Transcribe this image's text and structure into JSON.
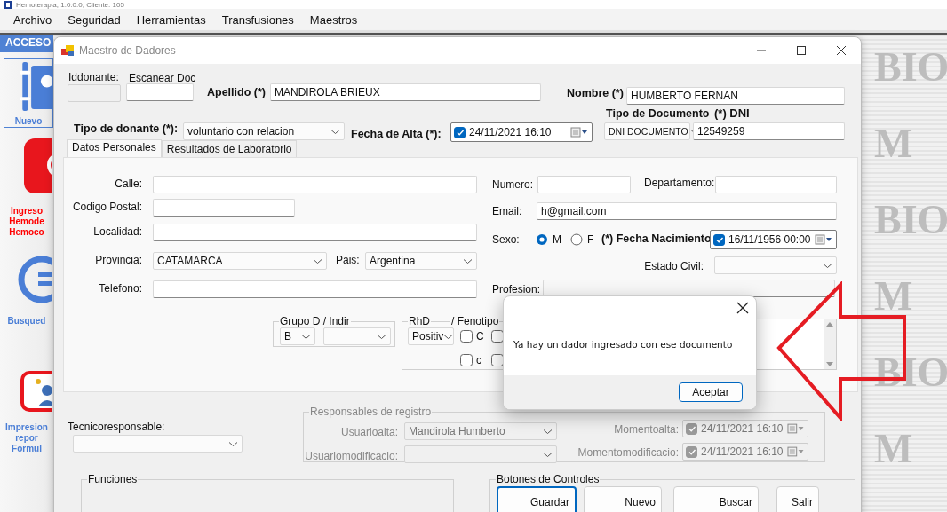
{
  "app": {
    "title": "Hemoterapia, 1.0.0.0, Cliente: 105"
  },
  "menu": [
    {
      "label": "Archivo"
    },
    {
      "label": "Seguridad"
    },
    {
      "label": "Herramientas"
    },
    {
      "label": "Transfusiones"
    },
    {
      "label": "Maestros"
    }
  ],
  "sidebar": {
    "title": "ACCESO",
    "items": [
      {
        "kind": "binder",
        "lines": [
          "Nuevo"
        ],
        "color": "#4a7ed6",
        "selected": true
      },
      {
        "kind": "entry",
        "lines": [
          "Ingreso",
          "Hemode",
          "Hemoco"
        ],
        "color": "#ff0000",
        "selected": false
      },
      {
        "kind": "search",
        "lines": [
          "Busqued"
        ],
        "color": "#4a7ed6",
        "selected": false
      },
      {
        "kind": "print",
        "lines": [
          "Impresion",
          "repor",
          "Formul"
        ],
        "color": "#4a7ed6",
        "selected": false
      }
    ]
  },
  "background_logo": [
    "BIO",
    "M",
    "BIO",
    "M",
    "BIO",
    "M"
  ],
  "dialog": {
    "title": "Maestro de Dadores",
    "header": {
      "iddonante": {
        "label": "Iddonante:",
        "kind": "text",
        "disabled": true
      },
      "escanear_doc": {
        "label": "Escanear Doc",
        "kind": "text"
      },
      "apellido": {
        "label": "Apellido (*)",
        "kind": "text",
        "value": "MANDIROLA BRIEUX"
      },
      "nombre": {
        "label": "Nombre (*)",
        "kind": "text",
        "value": "HUMBERTO FERNAN"
      },
      "tipo_donante": {
        "label": "Tipo de donante (*):",
        "kind": "combo",
        "value": "voluntario con relacion"
      },
      "fecha_alta": {
        "label": "Fecha de Alta (*):",
        "kind": "date",
        "checked": true,
        "value": "24/11/2021 16:10"
      },
      "tipo_documento": {
        "label": "Tipo de Documento",
        "kind": "combo",
        "value": "DNI DOCUMENTO"
      },
      "dni": {
        "label": "(*) DNI",
        "kind": "text",
        "value": "12549259"
      }
    },
    "tabs": [
      {
        "label": "Datos Personales",
        "selected": true
      },
      {
        "label": "Resultados de Laboratorio",
        "selected": false
      }
    ],
    "personal": {
      "calle": {
        "label": "Calle:",
        "kind": "text"
      },
      "codigo_postal": {
        "label": "Codigo Postal:",
        "kind": "text"
      },
      "localidad": {
        "label": "Localidad:",
        "kind": "text"
      },
      "provincia": {
        "label": "Provincia:",
        "kind": "combo",
        "value": "CATAMARCA"
      },
      "pais": {
        "label": "Pais:",
        "kind": "combo",
        "value": "Argentina"
      },
      "telefono": {
        "label": "Telefono:",
        "kind": "text"
      },
      "numero": {
        "label": "Numero:",
        "kind": "text"
      },
      "departamento": {
        "label": "Departamento:",
        "kind": "text"
      },
      "email": {
        "label": "Email:",
        "kind": "text",
        "value": "h@gmail.com"
      },
      "sexo": {
        "label": "Sexo:",
        "kind": "radio",
        "options": [
          {
            "label": "M",
            "selected": true
          },
          {
            "label": "F",
            "selected": false
          }
        ]
      },
      "fecha_nacimiento": {
        "label": "(*) Fecha Nacimiento",
        "kind": "date",
        "checked": true,
        "value": "16/11/1956 00:00"
      },
      "estado_civil": {
        "label": "Estado Civil:",
        "kind": "combo"
      },
      "profesion": {
        "label": "Profesion:",
        "kind": "text"
      },
      "grupo_box": {
        "kind": "group",
        "title": "Grupo D / Indir",
        "fields": {
          "grupo": {
            "kind": "combo",
            "value": "B"
          },
          "indir": {
            "kind": "combo"
          }
        }
      },
      "rhd_box": {
        "kind": "group",
        "title": "RhD",
        "note": "/ Fenotipo",
        "fields": {
          "rhd": {
            "kind": "combo",
            "value": "Positiv"
          },
          "fenotipo": {
            "kind": "checks",
            "items": [
              {
                "label": "C",
                "checked": false
              },
              {
                "label": "c",
                "checked": false
              },
              {
                "checked": false
              },
              {
                "checked": false
              }
            ]
          }
        }
      }
    },
    "footer": {
      "tecnicoresponsable": {
        "label": "Tecnicoresponsable:",
        "kind": "combo"
      },
      "responsables": {
        "kind": "group",
        "title": "Responsables de registro",
        "disabled": true,
        "fields": {
          "usuarioalta": {
            "label": "Usuarioalta:",
            "kind": "combo",
            "value": "Mandirola Humberto"
          },
          "usuariomodificacio": {
            "label": "Usuariomodificacio:",
            "kind": "combo"
          },
          "momentoalta": {
            "label": "Momentoalta:",
            "kind": "date",
            "checked": true,
            "value": "24/11/2021 16:10"
          },
          "momentomodificacio": {
            "label": "Momentomodificacio:",
            "kind": "date",
            "checked": true,
            "value": "24/11/2021 16:10"
          }
        }
      },
      "funciones": {
        "kind": "group",
        "title": "Funciones"
      },
      "botones": {
        "kind": "group",
        "title": "Botones de Controles",
        "fields": {
          "guardar": {
            "kind": "button",
            "label": "Guardar",
            "focused": true
          },
          "nuevo": {
            "kind": "button",
            "label": "Nuevo",
            "focused": false
          },
          "buscar": {
            "kind": "button",
            "label": "Buscar",
            "focused": false
          },
          "salir": {
            "kind": "button",
            "label": "Salir",
            "focused": false
          }
        }
      }
    }
  },
  "message_box": {
    "text": "Ya hay un dador ingresado con ese documento",
    "button": "Aceptar"
  }
}
